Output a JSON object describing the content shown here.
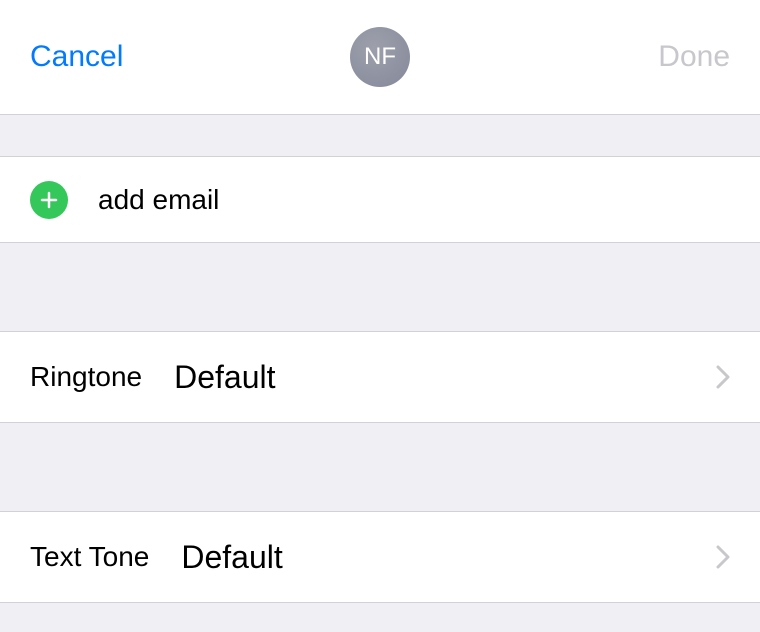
{
  "header": {
    "cancel_label": "Cancel",
    "avatar_initials": "NF",
    "done_label": "Done"
  },
  "add_email": {
    "label": "add email"
  },
  "ringtone": {
    "label": "Ringtone",
    "value": "Default"
  },
  "text_tone": {
    "label": "Text Tone",
    "value": "Default"
  }
}
